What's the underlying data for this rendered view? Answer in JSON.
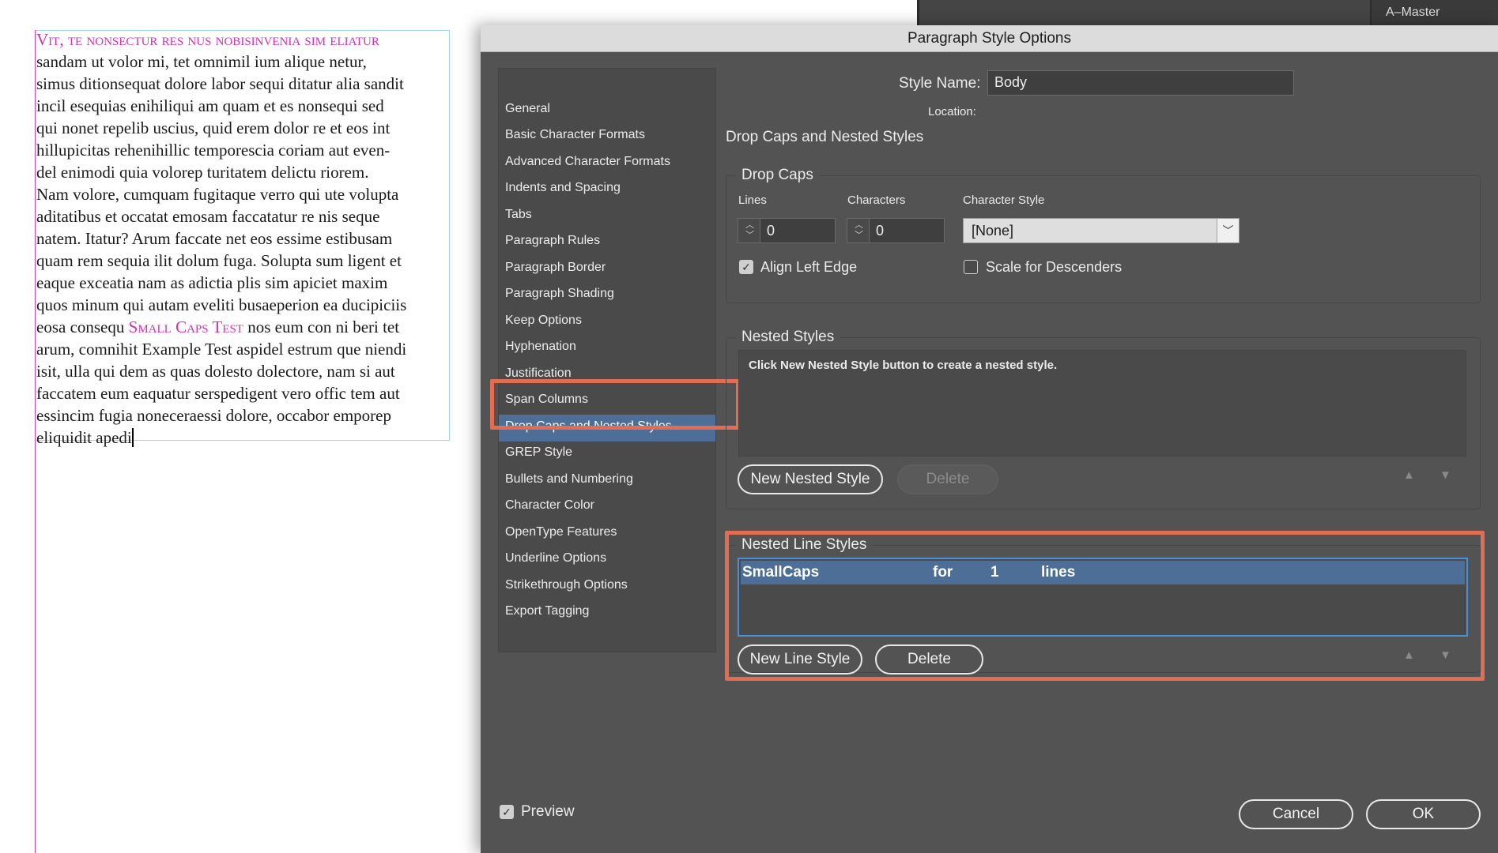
{
  "document": {
    "heading": "Vit, te nonsectur res nus nobisinvenia sim eliatur",
    "lines": [
      "sandam ut volor mi, tet omnimil ium alique netur,",
      "simus ditionsequat dolore labor sequi ditatur alia sandit",
      "incil esequias enihiliqui am quam et es nonsequi sed",
      "qui nonet repelib uscius, quid erem dolor re et eos int",
      "hillupicitas rehenihillic temporescia coriam aut even-",
      "del enimodi quia volorep turitatem delictu riorem.",
      "Nam volore, cumquam fugitaque verro qui ute volupta",
      "aditatibus et occatat emosam faccatatur re nis seque",
      "natem. Itatur? Arum faccate net eos essime estibusam",
      "quam rem sequia ilit dolum fuga. Solupta sum ligent et",
      "eaque exceatia nam as adictia plis sim apiciet maxim",
      "quos minum qui autam eveliti busaeperion ea ducipiciis"
    ],
    "line_sc_before": "eosa consequ ",
    "line_sc_text": "Small Caps Test",
    "line_sc_after": " nos eum con ni beri tet",
    "lines_after": [
      "arum, comnihit Example Test aspidel estrum que niendi",
      "isit, ulla qui dem as quas dolesto dolectore, nam si aut",
      "faccatem eum eaquatur serspedigent vero offic tem aut",
      "essincim fugia noneceraessi dolore, occabor emporep"
    ],
    "last_line": "eliquidit apedi"
  },
  "background_panel": {
    "tab_label": "A–Master"
  },
  "dialog": {
    "title": "Paragraph Style Options",
    "sidebar": {
      "items": [
        "General",
        "Basic Character Formats",
        "Advanced Character Formats",
        "Indents and Spacing",
        "Tabs",
        "Paragraph Rules",
        "Paragraph Border",
        "Paragraph Shading",
        "Keep Options",
        "Hyphenation",
        "Justification",
        "Span Columns",
        "Drop Caps and Nested Styles",
        "GREP Style",
        "Bullets and Numbering",
        "Character Color",
        "OpenType Features",
        "Underline Options",
        "Strikethrough Options",
        "Export Tagging"
      ],
      "selected_index": 12
    },
    "style_name_label": "Style Name:",
    "style_name_value": "Body",
    "location_label": "Location:",
    "section_title": "Drop Caps and Nested Styles",
    "drop_caps": {
      "legend": "Drop Caps",
      "lines_label": "Lines",
      "lines_value": "0",
      "characters_label": "Characters",
      "characters_value": "0",
      "character_style_label": "Character Style",
      "character_style_value": "[None]",
      "align_left_edge_label": "Align Left Edge",
      "align_left_edge_checked": true,
      "scale_for_descenders_label": "Scale for Descenders",
      "scale_for_descenders_checked": false
    },
    "nested_styles": {
      "legend": "Nested Styles",
      "empty_message": "Click New Nested Style button to create a nested style.",
      "new_button": "New Nested Style",
      "delete_button": "Delete"
    },
    "nested_line_styles": {
      "legend": "Nested Line Styles",
      "rows": [
        {
          "style": "SmallCaps",
          "for": "for",
          "count": "1",
          "unit": "lines"
        }
      ],
      "new_button": "New Line Style",
      "delete_button": "Delete"
    },
    "preview_label": "Preview",
    "preview_checked": true,
    "cancel_button": "Cancel",
    "ok_button": "OK",
    "highlight_color": "#e36d52",
    "selection_color": "#4c6e97"
  }
}
